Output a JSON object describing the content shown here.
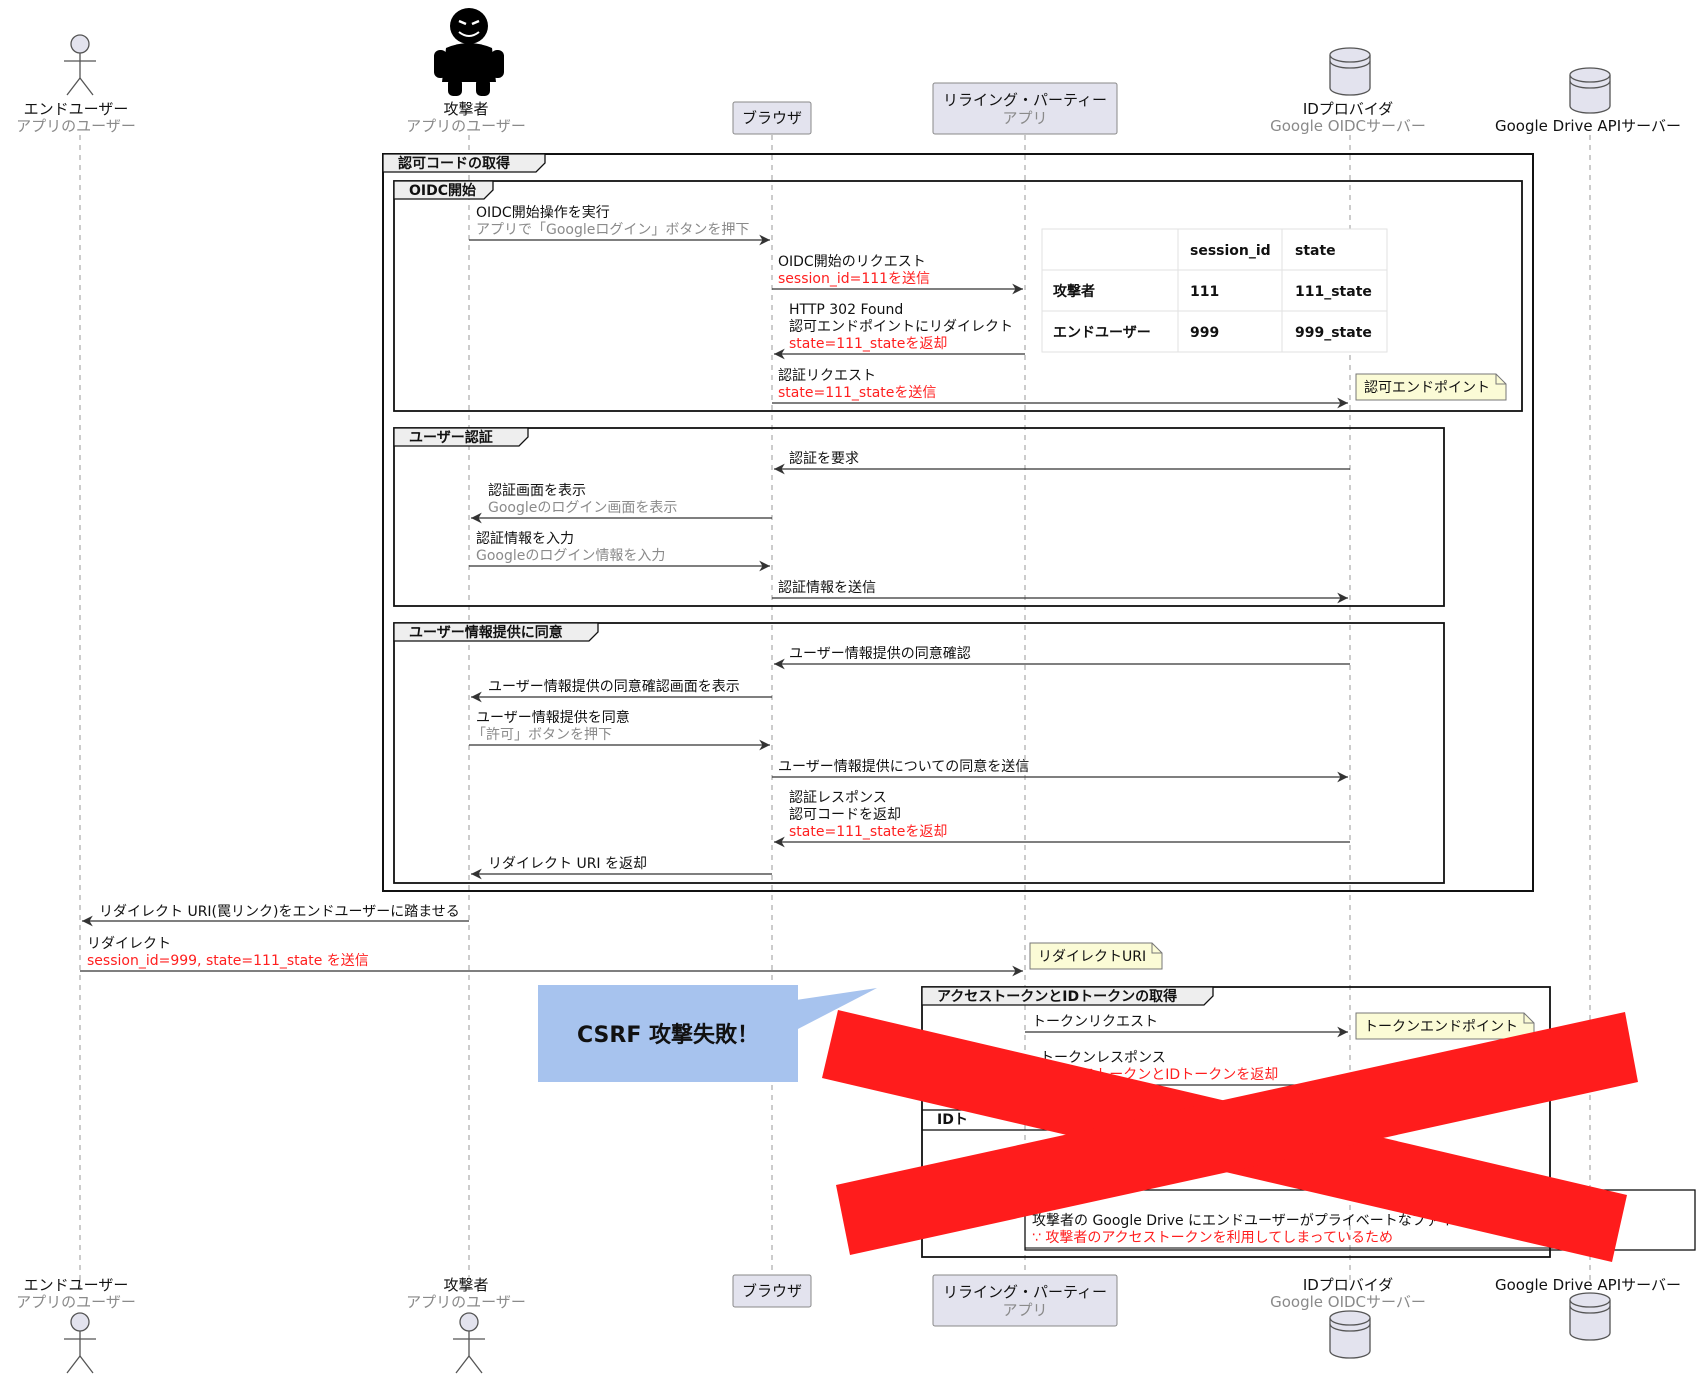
{
  "participants": {
    "enduser": {
      "name": "エンドユーザー",
      "sub": "アプリのユーザー"
    },
    "attacker": {
      "name": "攻撃者",
      "sub": "アプリのユーザー"
    },
    "browser": {
      "name": "ブラウザ"
    },
    "rp": {
      "name": "リライング・パーティー",
      "sub": "アプリ"
    },
    "idp": {
      "name": "IDプロバイダ",
      "sub": "Google OIDCサーバー"
    },
    "gdrive": {
      "name": "Google Drive APIサーバー"
    }
  },
  "groups": {
    "authcode": "認可コードの取得",
    "oidc_start": "OIDC開始",
    "user_auth": "ユーザー認証",
    "consent": "ユーザー情報提供に同意",
    "token": "アクセストークンとIDトークンの取得",
    "idtoken_partial": "IDト"
  },
  "messages": {
    "m1": [
      "OIDC開始操作を実行",
      "アプリで「Googleログイン」ボタンを押下"
    ],
    "m2": [
      "OIDC開始のリクエスト",
      "session_id=111を送信"
    ],
    "m3": [
      "HTTP 302 Found",
      "認可エンドポイントにリダイレクト",
      "state=111_stateを返却"
    ],
    "m4": [
      "認証リクエスト",
      "state=111_stateを送信"
    ],
    "m5": [
      "認証を要求"
    ],
    "m6": [
      "認証画面を表示",
      "Googleのログイン画面を表示"
    ],
    "m7": [
      "認証情報を入力",
      "Googleのログイン情報を入力"
    ],
    "m8": [
      "認証情報を送信"
    ],
    "m9": [
      "ユーザー情報提供の同意確認"
    ],
    "m10": [
      "ユーザー情報提供の同意確認画面を表示"
    ],
    "m11": [
      "ユーザー情報提供を同意",
      "「許可」ボタンを押下"
    ],
    "m12": [
      "ユーザー情報提供についての同意を送信"
    ],
    "m13": [
      "認証レスポンス",
      "認可コードを返却",
      "state=111_stateを返却"
    ],
    "m14": [
      "リダイレクト URI を返却"
    ],
    "m15": [
      "リダイレクト URI(罠リンク)をエンドユーザーに踏ませる"
    ],
    "m16": [
      "リダイレクト",
      "session_id=999, state=111_state を送信"
    ],
    "m17": [
      "トークンリクエスト"
    ],
    "m18": [
      "トークンレスポンス",
      "アクセストークンとIDトークンを返却"
    ],
    "m19": [
      "攻撃者の Google Drive にエンドユーザーがプライベートなファイ",
      "∵ 攻撃者のアクセストークンを利用してしまっているため"
    ]
  },
  "notes": {
    "authz_endpoint": "認可エンドポイント",
    "redirect_uri": "リダイレクトURI",
    "token_endpoint": "トークンエンドポイント"
  },
  "session_table": {
    "headers": [
      "",
      "session_id",
      "state"
    ],
    "rows": [
      [
        "攻撃者",
        "111",
        "111_state"
      ],
      [
        "エンドユーザー",
        "999",
        "999_state"
      ]
    ]
  },
  "callout": "CSRF 攻撃失敗！",
  "colors": {
    "red_text": "#ff1f1f",
    "cross": "#ff1c1c",
    "callout_bg": "#a7c3ee",
    "note_bg": "#fbfbd6",
    "participant_bg": "#e3e3ee"
  }
}
